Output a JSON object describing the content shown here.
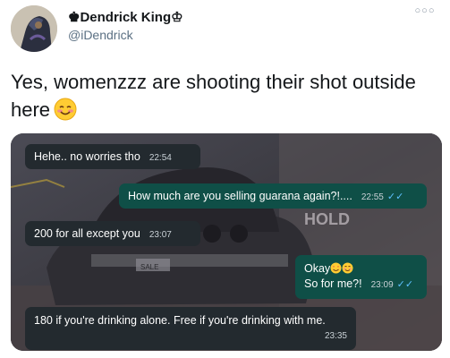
{
  "header": {
    "name": "Dendrick King",
    "handle": "@iDendrick",
    "more_icon": "more-icon"
  },
  "tweet": {
    "text": "Yes, womenzzz are shooting their shot outside here",
    "emoji": "smiling-face-with-hearts-emoji"
  },
  "chat": {
    "messages": [
      {
        "side": "incoming",
        "text": "Hehe.. no worries tho",
        "time": "22:54"
      },
      {
        "side": "outgoing",
        "text": "How much are you selling guarana again?!....",
        "time": "22:55",
        "status": "read"
      },
      {
        "side": "incoming",
        "text": "200 for all except you",
        "time": "23:07"
      },
      {
        "side": "outgoing",
        "text": "Okay",
        "text2": "So for me?!",
        "time": "23:09",
        "status": "read",
        "emojis": [
          "smiling-face-with-heart-eyes",
          "smiling-face"
        ]
      },
      {
        "side": "incoming",
        "text": "180 if you're drinking alone. Free if you're drinking with me.",
        "time": "23:35"
      }
    ],
    "background_text": "HOLD",
    "plate_text": "SALE"
  },
  "colors": {
    "incoming_bubble": "#232a2f",
    "outgoing_bubble": "#0f4f47",
    "read_ticks": "#5ec1ff"
  }
}
